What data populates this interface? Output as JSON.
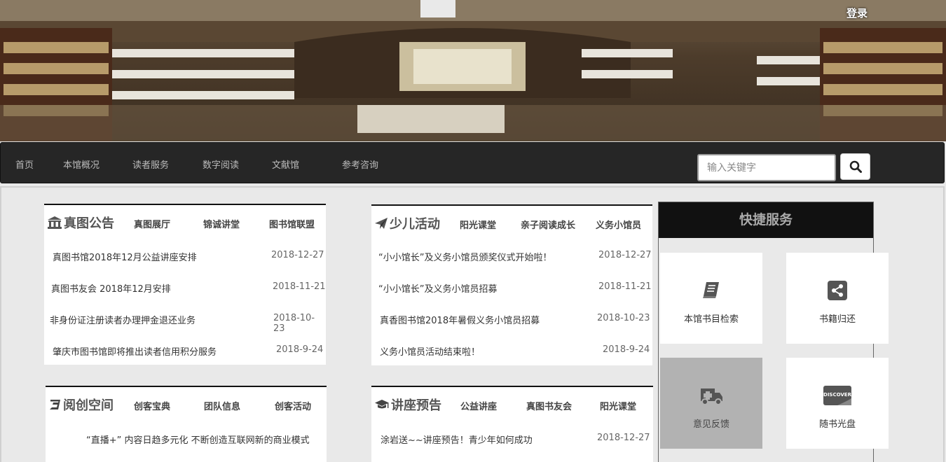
{
  "header": {
    "login_label": "登录"
  },
  "nav": {
    "items": [
      "首页",
      "本馆概况",
      "读者服务",
      "数字阅读",
      "文献馆",
      "参考咨询"
    ],
    "search_placeholder": "输入关键字"
  },
  "announcements": {
    "title": "真图公告",
    "tabs": [
      "真图展厅",
      "锦诚讲堂",
      "图书馆联盟"
    ],
    "items": [
      {
        "title": "真图书馆2018年12月公益讲座安排",
        "date": "2018-12-27"
      },
      {
        "title": "真图书友会 2018年12月安排",
        "date": "2018-11-21"
      },
      {
        "title": "非身份证注册读者办理押金退还业务",
        "date": "2018-10-23"
      },
      {
        "title": "肇庆市图书馆即将推出读者信用积分服务",
        "date": "2018-9-24"
      }
    ]
  },
  "children": {
    "title": "少儿活动",
    "tabs": [
      "阳光课堂",
      "亲子阅读成长",
      "义务小馆员"
    ],
    "items": [
      {
        "title": "“小小馆长”及义务小馆员颁奖仪式开始啦！",
        "date": "2018-12-27"
      },
      {
        "title": "“小小馆长”及义务小馆员招募",
        "date": "2018-11-21"
      },
      {
        "title": "真香图书馆2018年暑假义务小馆员招募",
        "date": "2018-10-23"
      },
      {
        "title": "义务小馆员活动结束啦！",
        "date": "2018-9-24"
      }
    ]
  },
  "space": {
    "title": "阅创空间",
    "tabs": [
      "创客宝典",
      "团队信息",
      "创客活动"
    ],
    "items": [
      {
        "title": "“直播+” 内容日趋多元化 不断创造互联网新的商业模式"
      }
    ]
  },
  "lectures": {
    "title": "讲座预告",
    "tabs": [
      "公益讲座",
      "真图书友会",
      "阳光课堂"
    ],
    "items": [
      {
        "title": "涂岩送~~讲座预告！青少年如何成功",
        "date": "2018-12-27"
      }
    ]
  },
  "quick": {
    "title": "快捷服务",
    "tiles": [
      {
        "label": "本馆书目检索",
        "icon": "book-icon"
      },
      {
        "label": "书籍归还",
        "icon": "share-icon"
      },
      {
        "label": "意见反馈",
        "icon": "ambulance-icon"
      },
      {
        "label": "随书光盘",
        "icon": "discover-card-icon"
      }
    ]
  },
  "colors": {
    "nav_bg": "#262626",
    "panel_border": "#111111",
    "quick_head_bg": "#111111",
    "tile_highlight": "#b2b2b2"
  }
}
